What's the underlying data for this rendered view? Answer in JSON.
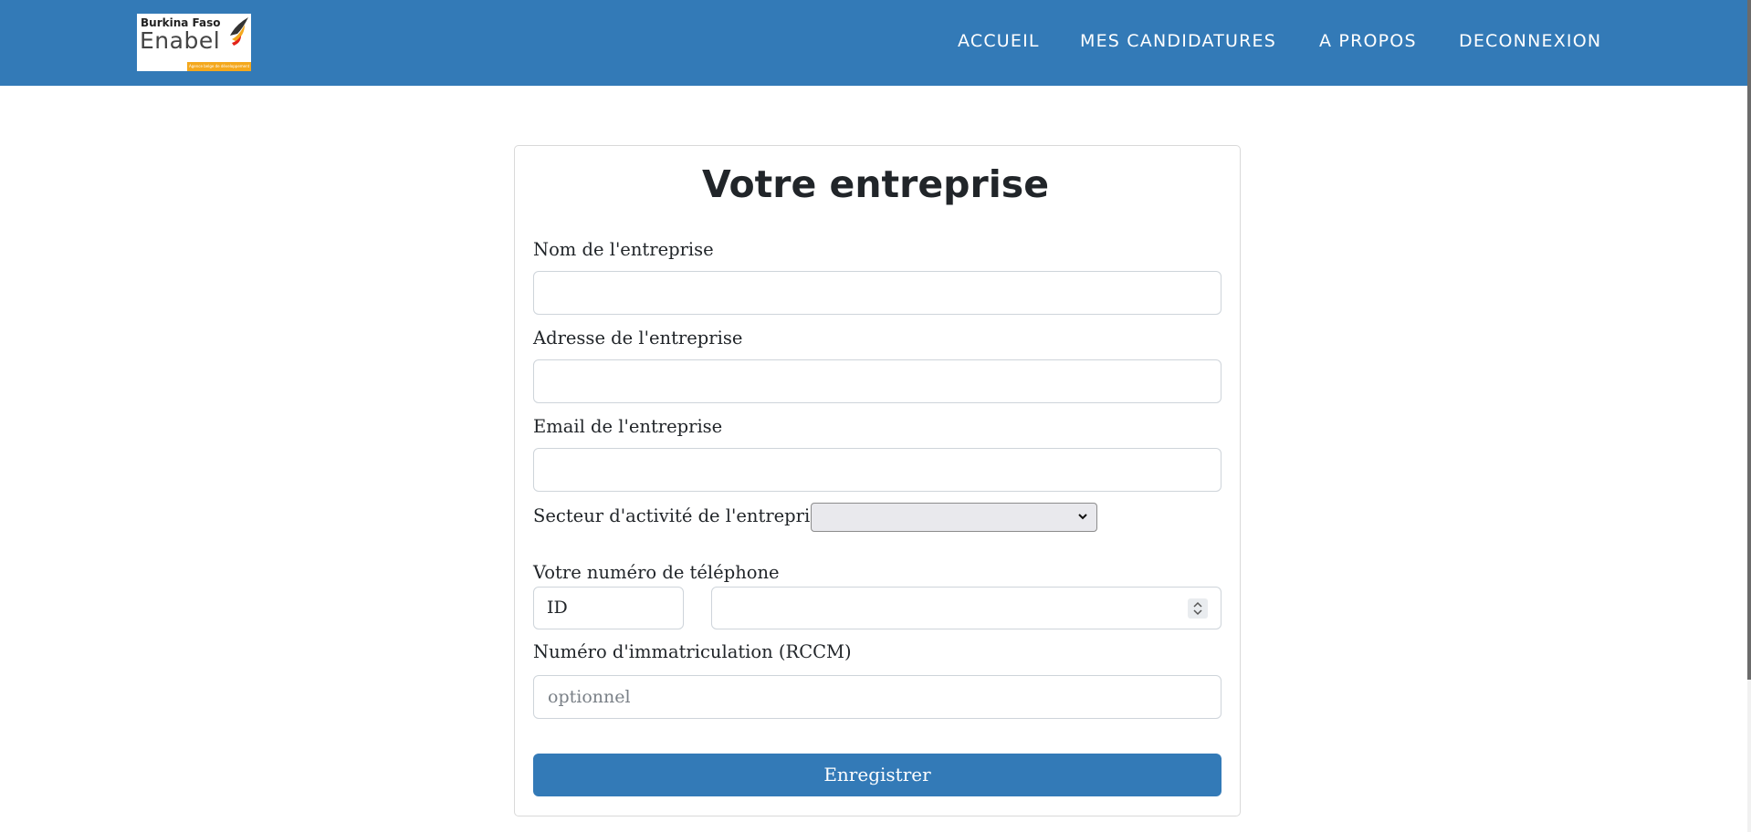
{
  "brand": {
    "logo_country": "Burkina Faso",
    "logo_name": "Enabel",
    "logo_tagline": "Agence belge de développement",
    "bar_color": "#337ab7"
  },
  "nav": {
    "items": [
      {
        "label": "ACCUEIL"
      },
      {
        "label": "MES CANDIDATURES"
      },
      {
        "label": "A PROPOS"
      },
      {
        "label": "DECONNEXION"
      }
    ]
  },
  "form": {
    "title": "Votre entreprise",
    "company_name": {
      "label": "Nom de l'entreprise",
      "value": ""
    },
    "company_address": {
      "label": "Adresse de l'entreprise",
      "value": ""
    },
    "company_email": {
      "label": "Email de l'entreprise",
      "value": ""
    },
    "sector": {
      "label": "Secteur d'activité de l'entreprise",
      "selected": ""
    },
    "phone": {
      "label": "Votre numéro de téléphone",
      "prefix": "ID",
      "value": ""
    },
    "rccm": {
      "label": "Numéro d'immatriculation (RCCM)",
      "placeholder": "optionnel",
      "value": ""
    },
    "submit_label": "Enregistrer"
  },
  "icons": {
    "select_arrow": "chevron-down-icon",
    "number_spinner": "spinner-icon"
  }
}
